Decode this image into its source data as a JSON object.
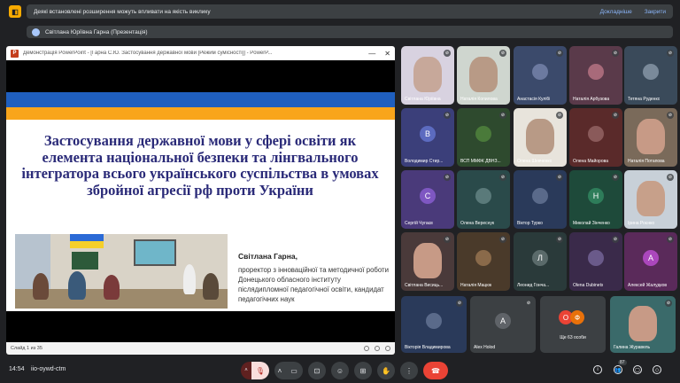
{
  "banner": {
    "icon": "meet-logo-icon",
    "message": "Деякі встановлені розширення можуть впливати на якість виклику",
    "details": "Докладніше",
    "close": "Закрити"
  },
  "presenter": {
    "label": "Світлана Юріївна Гарна (Презентація)"
  },
  "ppt": {
    "window_title": "Демонстрація PowerPoint - [Гарна С.Ю. Застосування державної мови [Режим сумісності]] - PowerP...",
    "heading": "Застосування державної мови у сфері освіти  як елемента національної безпеки та лінгвального інтегратора всього українського суспільства в умовах збройної агресії рф проти України",
    "speaker_name": "Світлана Гарна,",
    "speaker_role": "проректор з інноваційної та методичної роботи Донецького обласного інституту післядипломної педагогічної освіти, кандидат педагогічних наук",
    "status": "Слайд 1 из 35"
  },
  "tiles": [
    {
      "name": "Світлана Юріївна",
      "type": "video",
      "bg": "#d8d2e0",
      "face": "#c7a89a"
    },
    {
      "name": "Наталія Копилова",
      "type": "video",
      "bg": "#cfd6cf",
      "face": "#b89a86"
    },
    {
      "name": "Анастасія Кулібі",
      "type": "avatar",
      "bg": "#3b4a6b",
      "avatar_bg": "#6c7aa0",
      "letter": ""
    },
    {
      "name": "Наталія Арбузова",
      "type": "avatar",
      "bg": "#5a3a4a",
      "avatar_bg": "#a86a7a",
      "letter": ""
    },
    {
      "name": "Тетяна Руденко",
      "type": "avatar",
      "bg": "#3a4a5a",
      "avatar_bg": "#7a8a9a",
      "letter": ""
    },
    {
      "name": "Володимир Стир...",
      "type": "avatar",
      "bg": "#3b3f7a",
      "avatar_bg": "#5c6bc0",
      "letter": "В"
    },
    {
      "name": "ВСП ММФК ДВНЗ...",
      "type": "avatar",
      "bg": "#2e4a2e",
      "avatar_bg": "#4a7a3a",
      "letter": ""
    },
    {
      "name": "Олена Шевченко",
      "type": "video",
      "bg": "#e8e4dc",
      "face": "#b89a86"
    },
    {
      "name": "Олена Майорова",
      "type": "avatar",
      "bg": "#5a2a2a",
      "avatar_bg": "#8a5a5a",
      "letter": ""
    },
    {
      "name": "Наталія Потапова",
      "type": "video",
      "bg": "#7a6a5a",
      "face": "#c79a86"
    },
    {
      "name": "Сергій Чугаєв",
      "type": "avatar",
      "bg": "#4a3a7a",
      "avatar_bg": "#7e57c2",
      "letter": "С"
    },
    {
      "name": "Олена Вереснук",
      "type": "avatar",
      "bg": "#2a4a4a",
      "avatar_bg": "#5a7a7a",
      "letter": ""
    },
    {
      "name": "Віктор Турко",
      "type": "avatar",
      "bg": "#2a3a5a",
      "avatar_bg": "#5a6a8a",
      "letter": ""
    },
    {
      "name": "Миколай Зінченко",
      "type": "avatar",
      "bg": "#1e4a3a",
      "avatar_bg": "#2e7d5a",
      "letter": "Н"
    },
    {
      "name": "Ірина Роєнко",
      "type": "video",
      "bg": "#c8d0d8",
      "face": "#c7a08a"
    },
    {
      "name": "Світлана Висиць...",
      "type": "video",
      "bg": "#4a3a3a",
      "face": "#c79a86"
    },
    {
      "name": "Наталія Мацюк",
      "type": "avatar",
      "bg": "#4a3a2a",
      "avatar_bg": "#8a6a4a",
      "letter": ""
    },
    {
      "name": "Леонид Гонча...",
      "type": "avatar",
      "bg": "#2a3a3a",
      "avatar_bg": "#5a6a6a",
      "letter": "Л"
    },
    {
      "name": "Olena Dubinets",
      "type": "avatar",
      "bg": "#3a2a4a",
      "avatar_bg": "#6a5a8a",
      "letter": ""
    },
    {
      "name": "Алексей Жалудков",
      "type": "avatar",
      "bg": "#5a2a5a",
      "avatar_bg": "#ab47bc",
      "letter": "А"
    },
    {
      "name": "Вікторія Владимирова",
      "type": "avatar",
      "bg": "#2a3a5a",
      "avatar_bg": "#5a6a8a",
      "letter": ""
    },
    {
      "name": "Alex Holod",
      "type": "avatar",
      "bg": "#3c4043",
      "avatar_bg": "#5f6368",
      "letter": "A"
    },
    {
      "name": "Ще 63 особи",
      "type": "more",
      "bg": "#3c4043"
    },
    {
      "name": "Галина Журавель",
      "type": "video",
      "bg": "#3a6a6a",
      "face": "#c79a86"
    }
  ],
  "more_avatars": [
    "О",
    "Ф"
  ],
  "bottom": {
    "time": "14:54",
    "code": "iio-oywd-ctm",
    "participants_count": "87"
  },
  "icons": {
    "mic_off": "mic-off-icon",
    "camera": "camera-icon",
    "captions": "captions-icon",
    "emoji": "emoji-icon",
    "present": "present-icon",
    "raise_hand": "raise-hand-icon",
    "more": "more-options-icon",
    "end_call": "end-call-icon",
    "info": "info-icon",
    "people": "people-icon",
    "chat": "chat-icon",
    "activities": "activities-icon"
  }
}
